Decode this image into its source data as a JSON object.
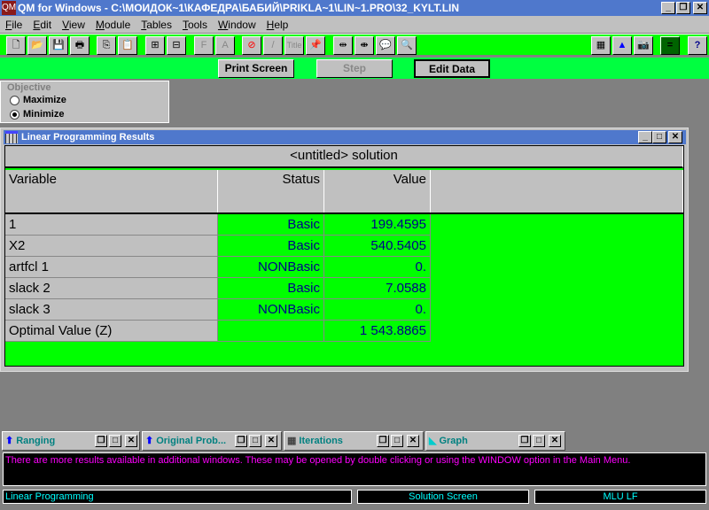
{
  "app": {
    "title": "QM for Windows - C:\\МОИДОК~1\\КАФЕДРА\\БАБИЙ\\PRIKLA~1\\LIN~1.PRO\\32_KYLT.LIN"
  },
  "menu": [
    "File",
    "Edit",
    "View",
    "Module",
    "Tables",
    "Tools",
    "Window",
    "Help"
  ],
  "toolbar": {
    "step": "Step",
    "print_screen": "Print Screen",
    "edit_data": "Edit Data"
  },
  "objective": {
    "legend": "Objective",
    "options": [
      "Maximize",
      "Minimize"
    ],
    "selected": "Minimize"
  },
  "results": {
    "title": "Linear Programming Results",
    "solution_title": "<untitled> solution",
    "columns": [
      "Variable",
      "Status",
      "Value"
    ],
    "rows": [
      {
        "variable": "1",
        "status": "Basic",
        "value": "199.4595"
      },
      {
        "variable": "X2",
        "status": "Basic",
        "value": "540.5405"
      },
      {
        "variable": "artfcl 1",
        "status": "NONBasic",
        "value": "0."
      },
      {
        "variable": "slack 2",
        "status": "Basic",
        "value": "7.0588"
      },
      {
        "variable": "slack 3",
        "status": "NONBasic",
        "value": "0."
      },
      {
        "variable": "Optimal Value (Z)",
        "status": "",
        "value": "1 543.8865"
      }
    ]
  },
  "minimized_windows": [
    "Ranging",
    "Original Prob...",
    "Iterations",
    "Graph"
  ],
  "message": "There are more results available in additional windows. These may be opened by double clicking or using the WINDOW option in the Main Menu.",
  "status": {
    "module": "Linear Programming",
    "screen": "Solution Screen",
    "mode": "MLU LF"
  }
}
